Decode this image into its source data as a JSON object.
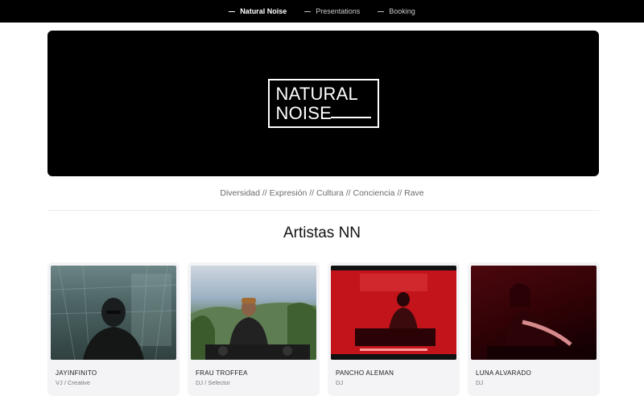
{
  "nav": {
    "items": [
      {
        "label": "Natural Noise",
        "active": true
      },
      {
        "label": "Presentations",
        "active": false
      },
      {
        "label": "Booking",
        "active": false
      }
    ]
  },
  "hero": {
    "logo_line1": "NATURAL",
    "logo_line2": "NOISE"
  },
  "tagline": "Diversidad // Expresión // Cultura // Conciencia // Rave",
  "artists_section": {
    "title": "Artistas NN",
    "cards": [
      {
        "name": "JAYINFINITO",
        "role": "VJ / Creative"
      },
      {
        "name": "FRAU TROFFEA",
        "role": "DJ / Selector"
      },
      {
        "name": "PANCHO ALEMAN",
        "role": "DJ"
      },
      {
        "name": "LUNA ALVARADO",
        "role": "DJ"
      }
    ]
  },
  "colors": {
    "nav_bg": "#000000",
    "hero_bg": "#000000",
    "card_bg": "#f4f4f7"
  }
}
